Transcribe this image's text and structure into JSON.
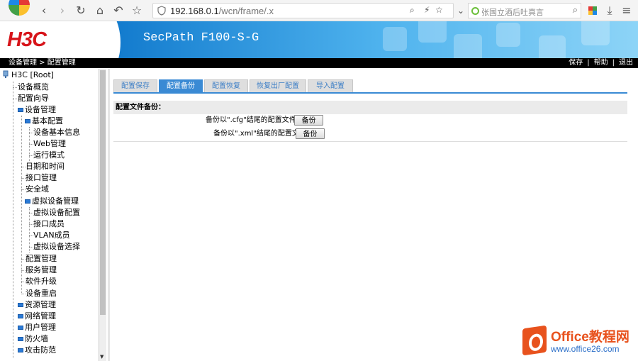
{
  "browser": {
    "url_host": "192.168.0.1",
    "url_path": "/wcn/frame/.x",
    "search_placeholder": "张国立酒后吐真言"
  },
  "header": {
    "logo": "H3C",
    "product": "SecPath F100-S-G"
  },
  "statusbar": {
    "breadcrumb": "设备管理 > 配置管理",
    "save": "保存",
    "help": "帮助",
    "logout": "退出",
    "sep": "|"
  },
  "tree": {
    "root": "H3C [Root]",
    "items": [
      "设备概览",
      "配置向导",
      "设备管理",
      "基本配置",
      "设备基本信息",
      "Web管理",
      "运行模式",
      "日期和时间",
      "接口管理",
      "安全域",
      "虚拟设备管理",
      "虚拟设备配置",
      "接口成员",
      "VLAN成员",
      "虚拟设备选择",
      "配置管理",
      "服务管理",
      "软件升级",
      "设备重启",
      "资源管理",
      "网络管理",
      "用户管理",
      "防火墙",
      "攻击防范"
    ]
  },
  "tabs": [
    "配置保存",
    "配置备份",
    "配置恢复",
    "恢复出厂配置",
    "导入配置"
  ],
  "active_tab": "配置备份",
  "section": {
    "title": "配置文件备份：",
    "rows": [
      {
        "label": "备份以\".cfg\"结尾的配置文件",
        "button": "备份"
      },
      {
        "label": "备份以\".xml\"结尾的配置文件",
        "button": "备份"
      }
    ]
  },
  "watermark": {
    "title": "Office教程网",
    "url": "www.office26.com"
  },
  "colors": {
    "logo_red": "#d7141a",
    "header_blue": "#0a73c9",
    "tab_active": "#3a8ad4",
    "tab_text": "#3d7fc6",
    "watermark_orange": "#e8521d"
  }
}
